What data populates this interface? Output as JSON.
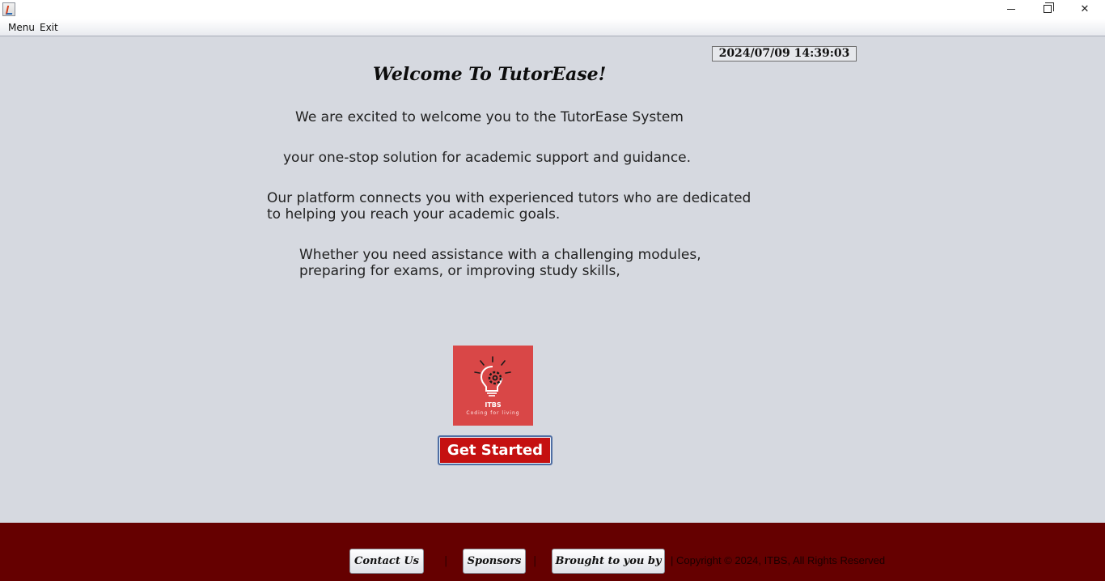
{
  "window": {
    "icon": "java-app-icon",
    "controls": {
      "minimize": "minimize-icon",
      "maximize": "restore-icon",
      "close": "close-icon"
    },
    "close_glyph": "✕"
  },
  "menubar": {
    "items": [
      {
        "label": "Menu"
      },
      {
        "label": "Exit"
      }
    ]
  },
  "main": {
    "datetime": "2024/07/09 14:39:03",
    "title": "Welcome To TutorEase!",
    "paragraphs": {
      "p1": "We are excited to welcome you to the TutorEase System",
      "p2": "your one-stop solution for academic support and guidance.",
      "p3_line1": "Our platform connects you with experienced tutors who are dedicated",
      "p3_line2": "to helping you reach your academic goals.",
      "p4_line1": "Whether you need assistance with a challenging modules,",
      "p4_line2": "preparing for exams, or improving study skills,"
    },
    "logo": {
      "icon": "lightbulb-gear-icon",
      "title": "ITBS",
      "tagline": "Coding for living",
      "color": "#d94747"
    },
    "get_started_label": "Get Started",
    "accent": "#c51010"
  },
  "footer": {
    "background": "#650000",
    "contact_label": "Contact Us",
    "sponsors_label": "Sponsors",
    "brought_label": "Brought to you by",
    "separator": "|",
    "copyright": "| Copyright © 2024, ITBS, All Rights Reserved"
  }
}
